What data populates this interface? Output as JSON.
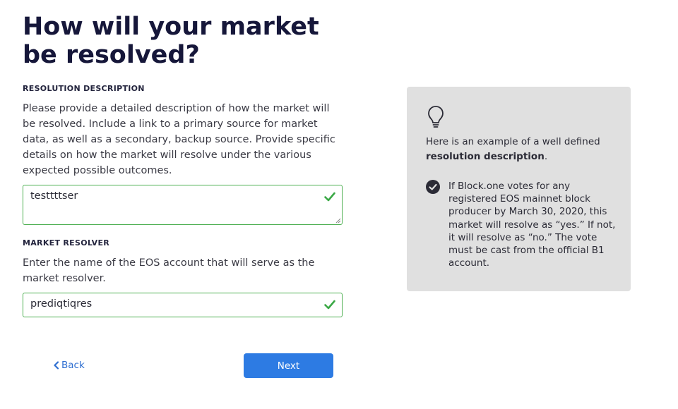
{
  "page": {
    "title": "How will your market be resolved?"
  },
  "resolution": {
    "label": "RESOLUTION DESCRIPTION",
    "help": "Please provide a detailed description of how the market will be resolved. Include a link to a primary source for market data, as well as a secondary, backup source. Provide specific details on how the market will resolve under the various expected possible outcomes.",
    "value": "testtttser",
    "valid": true
  },
  "resolver": {
    "label": "MARKET RESOLVER",
    "help": "Enter the name of the EOS account that will serve as the market resolver.",
    "value": "prediqtiqres",
    "valid": true
  },
  "nav": {
    "back_label": "Back",
    "next_label": "Next"
  },
  "example_panel": {
    "intro_prefix": "Here is an example of a well defined",
    "intro_bold": "resolution description",
    "intro_suffix": ".",
    "example_text": "If Block.one votes for any registered EOS mainnet block producer by March 30, 2020, this market will resolve as “yes.” If not, it will resolve as “no.” The vote must be cast from the official B1 account."
  },
  "colors": {
    "title": "#16173a",
    "valid_border": "#4caf50",
    "primary_button": "#2d7be3",
    "link": "#2f6fd1",
    "panel_bg": "#e0e0e0"
  }
}
